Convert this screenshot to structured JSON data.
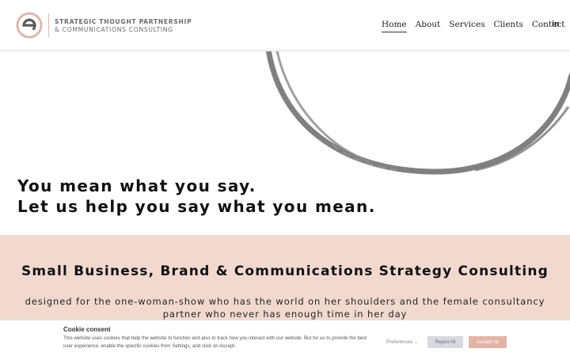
{
  "header": {
    "logo": {
      "icon": "e-circle-logo",
      "letter": "e"
    },
    "brand_line1": "STRATEGIC THOUGHT PARTNERSHIP",
    "brand_line2": "& COMMUNICATIONS CONSULTING",
    "nav": [
      {
        "label": "Home",
        "active": true
      },
      {
        "label": "About"
      },
      {
        "label": "Services"
      },
      {
        "label": "Clients"
      },
      {
        "label": "Contact"
      }
    ],
    "social": {
      "icon": "linkedin-icon",
      "label": "in"
    }
  },
  "hero": {
    "line1": "You mean what you say.",
    "line2": "Let us help you say what you mean.",
    "ring_color": "#808080"
  },
  "band": {
    "title": "Small Business, Brand & Communications Strategy Consulting",
    "subtitle": "designed for the one-woman-show who has the world on her shoulders and the female consultancy partner who never has enough time in her day",
    "background": "#f2d9cf"
  },
  "cookie": {
    "title": "Cookie consent",
    "text": "This website uses cookies that help the website to function and also to track how you interact with our website. But for us to provide the best user experience, enable the specific cookies from Settings, and click on Accept.",
    "preferences_label": "Preferences",
    "reject_label": "Reject All",
    "accept_label": "Accept All"
  },
  "colors": {
    "accent": "#d9b9ae",
    "accept_button": "#e0b5a8",
    "reject_button": "#d6d9dd"
  }
}
